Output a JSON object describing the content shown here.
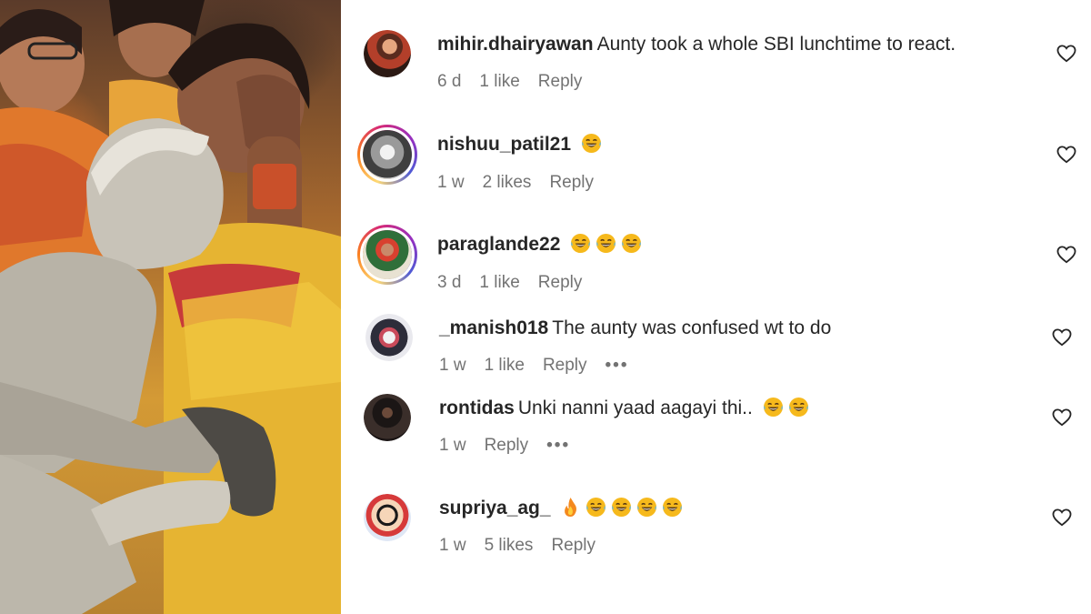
{
  "media": {
    "description_icon": "video-frame"
  },
  "comments": [
    {
      "username": "mihir.dhairyawan",
      "text": "Aunty took a whole SBI lunchtime to react.",
      "emojis": [],
      "time": "6 d",
      "likes": "1 like",
      "reply": "Reply",
      "has_more": false,
      "story_ring": false
    },
    {
      "username": "nishuu_patil21",
      "text": "",
      "emojis": [
        "laughing-tears-emoji"
      ],
      "time": "1 w",
      "likes": "2 likes",
      "reply": "Reply",
      "has_more": false,
      "story_ring": true
    },
    {
      "username": "paraglande22",
      "text": "",
      "emojis": [
        "laughing-tears-emoji",
        "laughing-tears-emoji",
        "laughing-tears-emoji"
      ],
      "time": "3 d",
      "likes": "1 like",
      "reply": "Reply",
      "has_more": false,
      "story_ring": true
    },
    {
      "username": "_manish018",
      "text": "The aunty was confused wt to do",
      "emojis": [],
      "time": "1 w",
      "likes": "1 like",
      "reply": "Reply",
      "has_more": true,
      "more_label": "•••",
      "story_ring": false
    },
    {
      "username": "rontidas",
      "text": "Unki nanni yaad aagayi thi..",
      "emojis": [
        "laughing-tears-emoji",
        "laughing-tears-emoji"
      ],
      "time": "1 w",
      "likes": "",
      "reply": "Reply",
      "has_more": true,
      "more_label": "•••",
      "story_ring": false
    },
    {
      "username": "supriya_ag_",
      "text": "",
      "emojis": [
        "fire-emoji",
        "laughing-tears-emoji",
        "laughing-tears-emoji",
        "laughing-tears-emoji",
        "laughing-tears-emoji"
      ],
      "time": "1 w",
      "likes": "5 likes",
      "reply": "Reply",
      "has_more": false,
      "story_ring": false
    }
  ],
  "colors": {
    "text": "#262626",
    "meta": "#737373",
    "emoji": "#f6b91c",
    "fire": "#f4891e"
  }
}
